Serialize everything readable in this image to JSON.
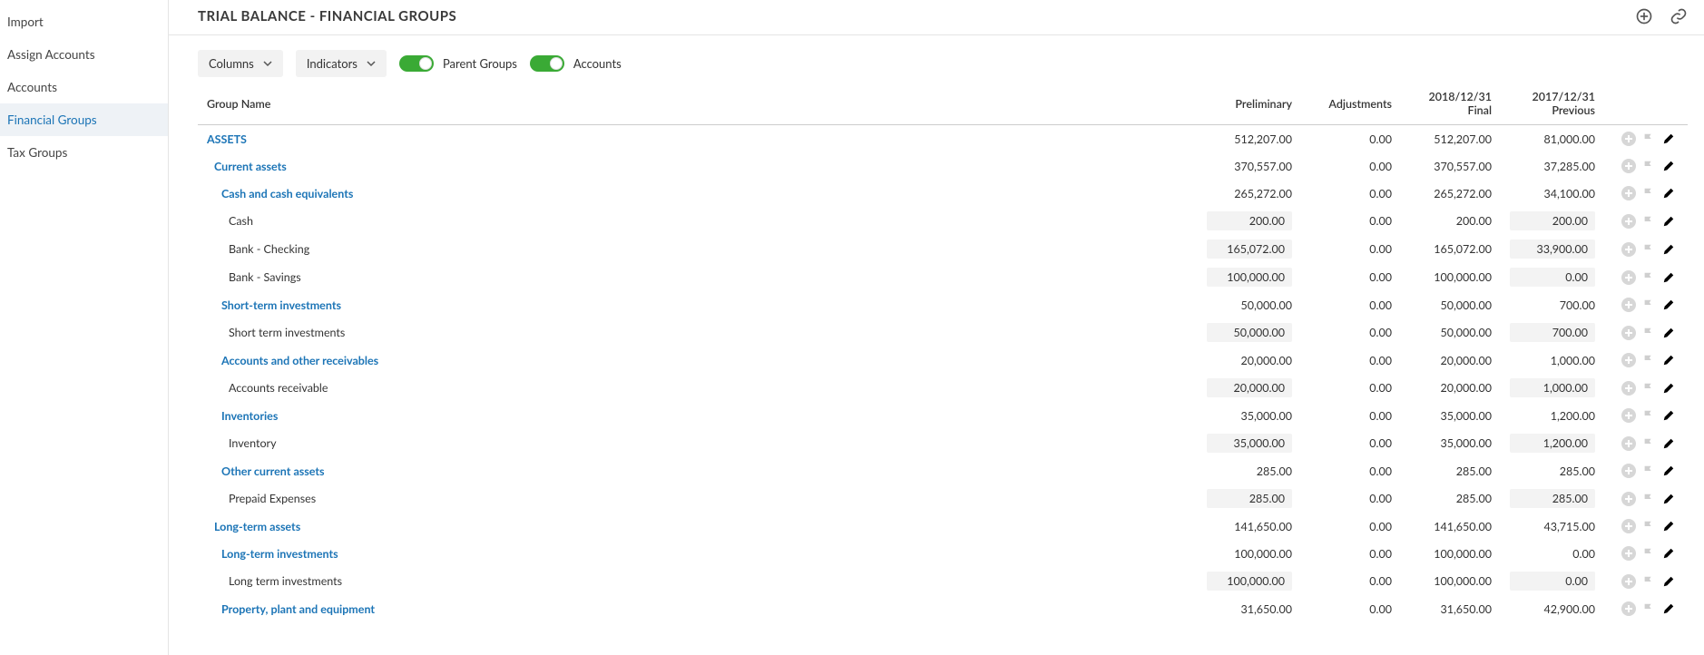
{
  "sidebar": {
    "items": [
      {
        "label": "Import",
        "active": false
      },
      {
        "label": "Assign Accounts",
        "active": false
      },
      {
        "label": "Accounts",
        "active": false
      },
      {
        "label": "Financial Groups",
        "active": true
      },
      {
        "label": "Tax Groups",
        "active": false
      }
    ]
  },
  "header": {
    "title": "TRIAL BALANCE - FINANCIAL GROUPS"
  },
  "toolbar": {
    "columns_label": "Columns",
    "indicators_label": "Indicators",
    "parent_groups_label": "Parent Groups",
    "accounts_label": "Accounts",
    "parent_groups_on": true,
    "accounts_on": true
  },
  "columns": {
    "group_name": "Group Name",
    "preliminary": "Preliminary",
    "adjustments": "Adjustments",
    "final_date": "2018/12/31",
    "final_label": "Final",
    "previous_date": "2017/12/31",
    "previous_label": "Previous"
  },
  "rows": [
    {
      "name": "ASSETS",
      "indent": 0,
      "link": true,
      "bold": true,
      "leaf": false,
      "prelim": "512,207.00",
      "adj": "0.00",
      "final": "512,207.00",
      "prev": "81,000.00"
    },
    {
      "name": "Current assets",
      "indent": 1,
      "link": true,
      "bold": true,
      "leaf": false,
      "prelim": "370,557.00",
      "adj": "0.00",
      "final": "370,557.00",
      "prev": "37,285.00"
    },
    {
      "name": "Cash and cash equivalents",
      "indent": 2,
      "link": true,
      "bold": true,
      "leaf": false,
      "prelim": "265,272.00",
      "adj": "0.00",
      "final": "265,272.00",
      "prev": "34,100.00"
    },
    {
      "name": "Cash",
      "indent": 3,
      "link": false,
      "bold": false,
      "leaf": true,
      "prelim": "200.00",
      "adj": "0.00",
      "final": "200.00",
      "prev": "200.00"
    },
    {
      "name": "Bank - Checking",
      "indent": 3,
      "link": false,
      "bold": false,
      "leaf": true,
      "prelim": "165,072.00",
      "adj": "0.00",
      "final": "165,072.00",
      "prev": "33,900.00"
    },
    {
      "name": "Bank - Savings",
      "indent": 3,
      "link": false,
      "bold": false,
      "leaf": true,
      "prelim": "100,000.00",
      "adj": "0.00",
      "final": "100,000.00",
      "prev": "0.00"
    },
    {
      "name": "Short-term investments",
      "indent": 2,
      "link": true,
      "bold": true,
      "leaf": false,
      "prelim": "50,000.00",
      "adj": "0.00",
      "final": "50,000.00",
      "prev": "700.00"
    },
    {
      "name": "Short term investments",
      "indent": 3,
      "link": false,
      "bold": false,
      "leaf": true,
      "prelim": "50,000.00",
      "adj": "0.00",
      "final": "50,000.00",
      "prev": "700.00"
    },
    {
      "name": "Accounts and other receivables",
      "indent": 2,
      "link": true,
      "bold": true,
      "leaf": false,
      "prelim": "20,000.00",
      "adj": "0.00",
      "final": "20,000.00",
      "prev": "1,000.00"
    },
    {
      "name": "Accounts receivable",
      "indent": 3,
      "link": false,
      "bold": false,
      "leaf": true,
      "prelim": "20,000.00",
      "adj": "0.00",
      "final": "20,000.00",
      "prev": "1,000.00"
    },
    {
      "name": "Inventories",
      "indent": 2,
      "link": true,
      "bold": true,
      "leaf": false,
      "prelim": "35,000.00",
      "adj": "0.00",
      "final": "35,000.00",
      "prev": "1,200.00"
    },
    {
      "name": "Inventory",
      "indent": 3,
      "link": false,
      "bold": false,
      "leaf": true,
      "prelim": "35,000.00",
      "adj": "0.00",
      "final": "35,000.00",
      "prev": "1,200.00"
    },
    {
      "name": "Other current assets",
      "indent": 2,
      "link": true,
      "bold": true,
      "leaf": false,
      "prelim": "285.00",
      "adj": "0.00",
      "final": "285.00",
      "prev": "285.00"
    },
    {
      "name": "Prepaid Expenses",
      "indent": 3,
      "link": false,
      "bold": false,
      "leaf": true,
      "prelim": "285.00",
      "adj": "0.00",
      "final": "285.00",
      "prev": "285.00"
    },
    {
      "name": "Long-term assets",
      "indent": 1,
      "link": true,
      "bold": true,
      "leaf": false,
      "prelim": "141,650.00",
      "adj": "0.00",
      "final": "141,650.00",
      "prev": "43,715.00"
    },
    {
      "name": "Long-term investments",
      "indent": 2,
      "link": true,
      "bold": true,
      "leaf": false,
      "prelim": "100,000.00",
      "adj": "0.00",
      "final": "100,000.00",
      "prev": "0.00"
    },
    {
      "name": "Long term investments",
      "indent": 3,
      "link": false,
      "bold": false,
      "leaf": true,
      "prelim": "100,000.00",
      "adj": "0.00",
      "final": "100,000.00",
      "prev": "0.00"
    },
    {
      "name": "Property, plant and equipment",
      "indent": 2,
      "link": true,
      "bold": true,
      "leaf": false,
      "prelim": "31,650.00",
      "adj": "0.00",
      "final": "31,650.00",
      "prev": "42,900.00"
    }
  ]
}
